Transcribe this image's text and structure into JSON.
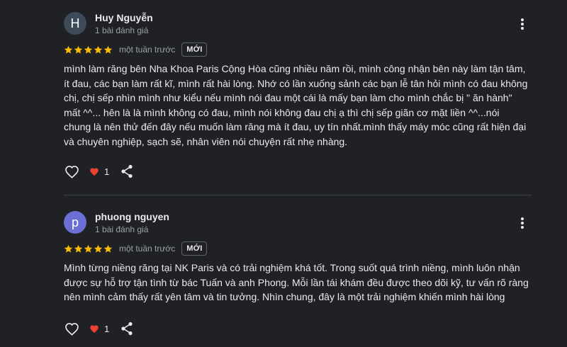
{
  "colors": {
    "background": "#202124",
    "star": "#fbbc04",
    "like_heart": "#ea4335",
    "avatar_1": "#3c4a5a",
    "avatar_2": "#6b6fd4"
  },
  "reviews": [
    {
      "avatar_letter": "H",
      "name": "Huy Nguyễn",
      "meta": "1 bài đánh giá",
      "rating": 5,
      "time": "một tuần trước",
      "badge": "MỚI",
      "text_lines": [
        "mình làm răng bên Nha Khoa Paris Cộng Hòa cũng nhiều năm rồi, mình công nhận bên này làm tận tâm,",
        "ít đau, các bạn làm rất kĩ, mình rất hài lòng. Nhớ có lần xuống sảnh các bạn lễ tân hỏi mình có đau không",
        "chị, chị sếp nhìn mình như kiểu nếu mình nói đau một cái là mấy bạn làm cho mình chắc bị \" ăn hành\"",
        "mất ^^... hên là là mình không có đau, mình nói không đau chị ạ thì chị sếp giãn cơ mặt liền ^^...nói",
        "chung là nên thử đến đây nếu muốn làm răng mà ít đau, uy tín nhất.mình thấy máy móc cũng rất hiện đại",
        "và chuyên nghiệp, sạch sẽ, nhân viên nói chuyện rất nhẹ nhàng."
      ],
      "likes": "1",
      "icons": {
        "more": "more-vert-icon",
        "heart": "heart-outline-icon",
        "liked": "heart-filled-icon",
        "share": "share-icon"
      }
    },
    {
      "avatar_letter": "p",
      "name": "phuong nguyen",
      "meta": "1 bài đánh giá",
      "rating": 5,
      "time": "một tuần trước",
      "badge": "MỚI",
      "text_lines": [
        "Mình từng niềng răng tại NK Paris và có trải nghiệm khá tốt. Trong suốt quá trình niềng, mình luôn nhận",
        "được sự hỗ trợ tận tình từ bác Tuấn và anh Phong. Mỗi lần tái khám đều được theo dõi kỹ, tư vấn rõ ràng",
        "nên mình cảm thấy rất yên tâm và tin tưởng. Nhìn chung, đây là một trải nghiệm khiến mình hài lòng"
      ],
      "likes": "1",
      "icons": {
        "more": "more-vert-icon",
        "heart": "heart-outline-icon",
        "liked": "heart-filled-icon",
        "share": "share-icon"
      }
    }
  ]
}
